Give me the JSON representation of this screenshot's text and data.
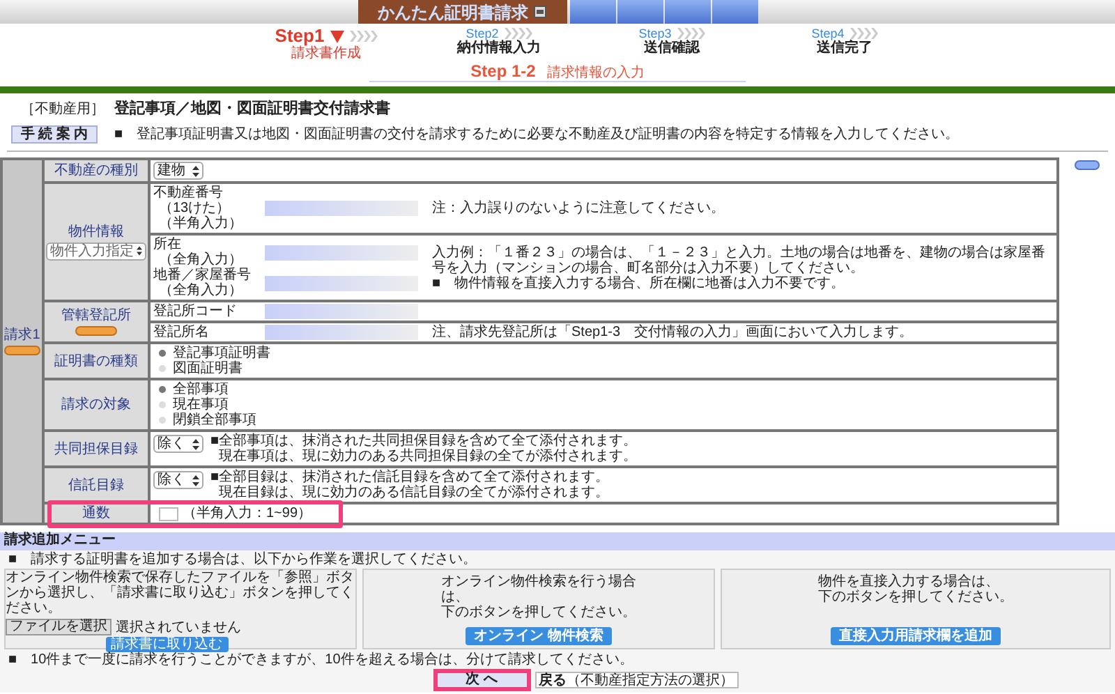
{
  "header": {
    "logo": "かんたん証明書請求"
  },
  "steps": [
    {
      "label": "Step1",
      "caption": "請求書作成",
      "selected": true
    },
    {
      "label": "Step2",
      "caption": "納付情報入力",
      "selected": false
    },
    {
      "label": "Step3",
      "caption": "送信確認",
      "selected": false
    },
    {
      "label": "Step4",
      "caption": "送信完了",
      "selected": false
    }
  ],
  "substep": {
    "number": "Step 1-2",
    "title": "請求情報の入力"
  },
  "form": {
    "category": "［不動産用］",
    "title": "登記事項／地図・図面証明書交付請求書",
    "guide_button": "手 続 案 内",
    "intro": "■　登記事項証明書又は地図・図面証明書の交付を請求するために必要な不動産及び証明書の内容を特定する情報を入力してください。"
  },
  "request": {
    "label": "請求1",
    "rows": [
      {
        "kind": "select",
        "label": "不動産の種別",
        "value": "建物"
      },
      {
        "kind": "subrows",
        "label": "物件情報",
        "mode_select": "物件入力指定",
        "subrows": [
          {
            "fields": [
              {
                "label_lines": [
                  "不動産番号",
                  "（13けた）",
                  "（半角入力）"
                ]
              }
            ],
            "notes": [
              "注：入力誤りのないように注意してください。"
            ]
          },
          {
            "fields": [
              {
                "label_lines": [
                  "所在",
                  "（全角入力）"
                ]
              },
              {
                "label_lines": [
                  "地番／家屋番号",
                  "（全角入力）"
                ]
              }
            ],
            "notes": [
              "入力例：「１番２３」の場合は、「１－２３」と入力。土地の場合は地番を、建物の場合は家屋番号を入力（マンションの場合、町名部分は入力不要）してください。",
              "■　物件情報を直接入力する場合、所在欄に地番は入力不要です。"
            ]
          }
        ]
      },
      {
        "kind": "subrows",
        "label": "管轄登記所",
        "has_button": true,
        "subrows": [
          {
            "fields": [
              {
                "label_lines": [
                  "登記所コード"
                ]
              }
            ]
          },
          {
            "fields": [
              {
                "label_lines": [
                  "登記所名"
                ]
              }
            ],
            "notes": [
              "注、請求先登記所は「Step1-3　交付情報の入力」画面において入力します。"
            ]
          }
        ]
      },
      {
        "kind": "radio",
        "label": "証明書の種類",
        "options": [
          {
            "label": "登記事項証明書",
            "selected": true
          },
          {
            "label": "図面証明書",
            "selected": false
          }
        ]
      },
      {
        "kind": "radio",
        "label": "請求の対象",
        "options": [
          {
            "label": "全部事項",
            "selected": true
          },
          {
            "label": "現在事項",
            "selected": false
          },
          {
            "label": "閉鎖全部事項",
            "selected": false
          }
        ]
      },
      {
        "kind": "select_notes",
        "label": "共同担保目録",
        "value": "除く",
        "notes": [
          "■全部事項は、抹消された共同担保目録を含めて全て添付されます。",
          "現在事項は、現に効力のある共同担保目録の全てが添付されます。"
        ]
      },
      {
        "kind": "select_notes",
        "label": "信託目録",
        "value": "除く",
        "notes": [
          "■全部目録は、抹消された信託目録を含めて全て添付されます。",
          "現在目録は、現に効力のある信託目録の全てが添付されます。"
        ]
      },
      {
        "kind": "count",
        "label": "通数",
        "hint": "（半角入力：1~99）",
        "highlighted": true
      }
    ]
  },
  "menu": {
    "title": "請求追加メニュー",
    "note": "■　請求する証明書を追加する場合は、以下から作業を選択してください。",
    "panels": [
      {
        "kind": "file",
        "lines": [
          "オンライン物件検索で保存したファイルを「参照」ボタンから選択し、「請求書に取り込む」ボタンを押してください。"
        ],
        "file_button": "ファイルを選択",
        "file_status": "選択されていません",
        "action": "請求書に取り込む"
      },
      {
        "kind": "button",
        "lines": [
          "オンライン物件検索を行う場合は、",
          "下のボタンを押してください。"
        ],
        "action": "オンライン 物件検索"
      },
      {
        "kind": "button",
        "lines": [
          "物件を直接入力する場合は、",
          "下のボタンを押してください。"
        ],
        "action": "直接入力用請求欄を追加"
      }
    ],
    "limit_note": "■　10件まで一度に請求を行うことができますが、10件を超える場合は、分けて請求してください。",
    "next": "次 へ",
    "back": "戻る",
    "back_note": "（不動産指定方法の選択）"
  }
}
